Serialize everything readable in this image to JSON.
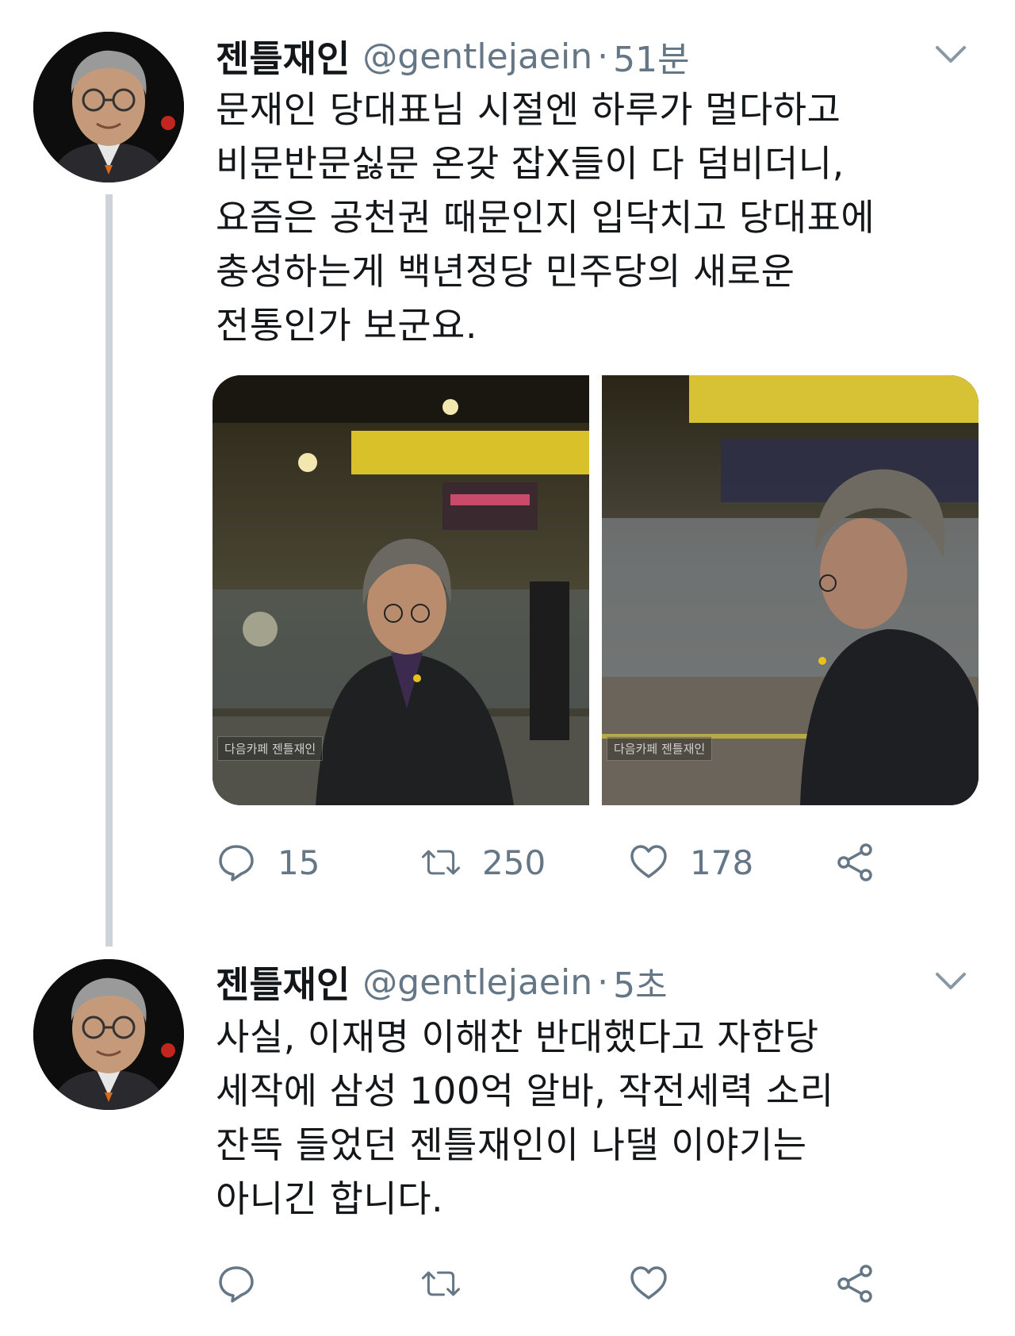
{
  "tweets": [
    {
      "name": "젠틀재인",
      "handle": "@gentlejaein",
      "separator": "·",
      "time": "51분",
      "text": "문재인 당대표님 시절엔 하루가 멀다하고\n비문반문싫문 온갖 잡X들이 다 덤비더니,\n요즘은 공천권 때문인지 입닥치고 당대표에\n충성하는게 백년정당 민주당의 새로운\n전통인가 보군요.",
      "media": [
        {
          "watermark": "다음카페 젠틀재인"
        },
        {
          "watermark": "다음카페 젠틀재인"
        }
      ],
      "stats": {
        "replies": "15",
        "retweets": "250",
        "likes": "178"
      }
    },
    {
      "name": "젠틀재인",
      "handle": "@gentlejaein",
      "separator": "·",
      "time": "5초",
      "text": "사실, 이재명 이해찬 반대했다고 자한당\n세작에 삼성 100억 알바, 작전세력 소리\n잔뜩 들었던 젠틀재인이 나댈 이야기는\n아니긴 합니다.",
      "stats": {
        "replies": "",
        "retweets": "",
        "likes": ""
      }
    }
  ],
  "icons": {
    "reply": "reply-icon",
    "retweet": "retweet-icon",
    "like": "heart-icon",
    "share": "share-icon",
    "menu": "chevron-down-icon"
  },
  "colors": {
    "text": "#14171a",
    "secondary": "#657786",
    "thread_line": "#cdd3d8"
  }
}
